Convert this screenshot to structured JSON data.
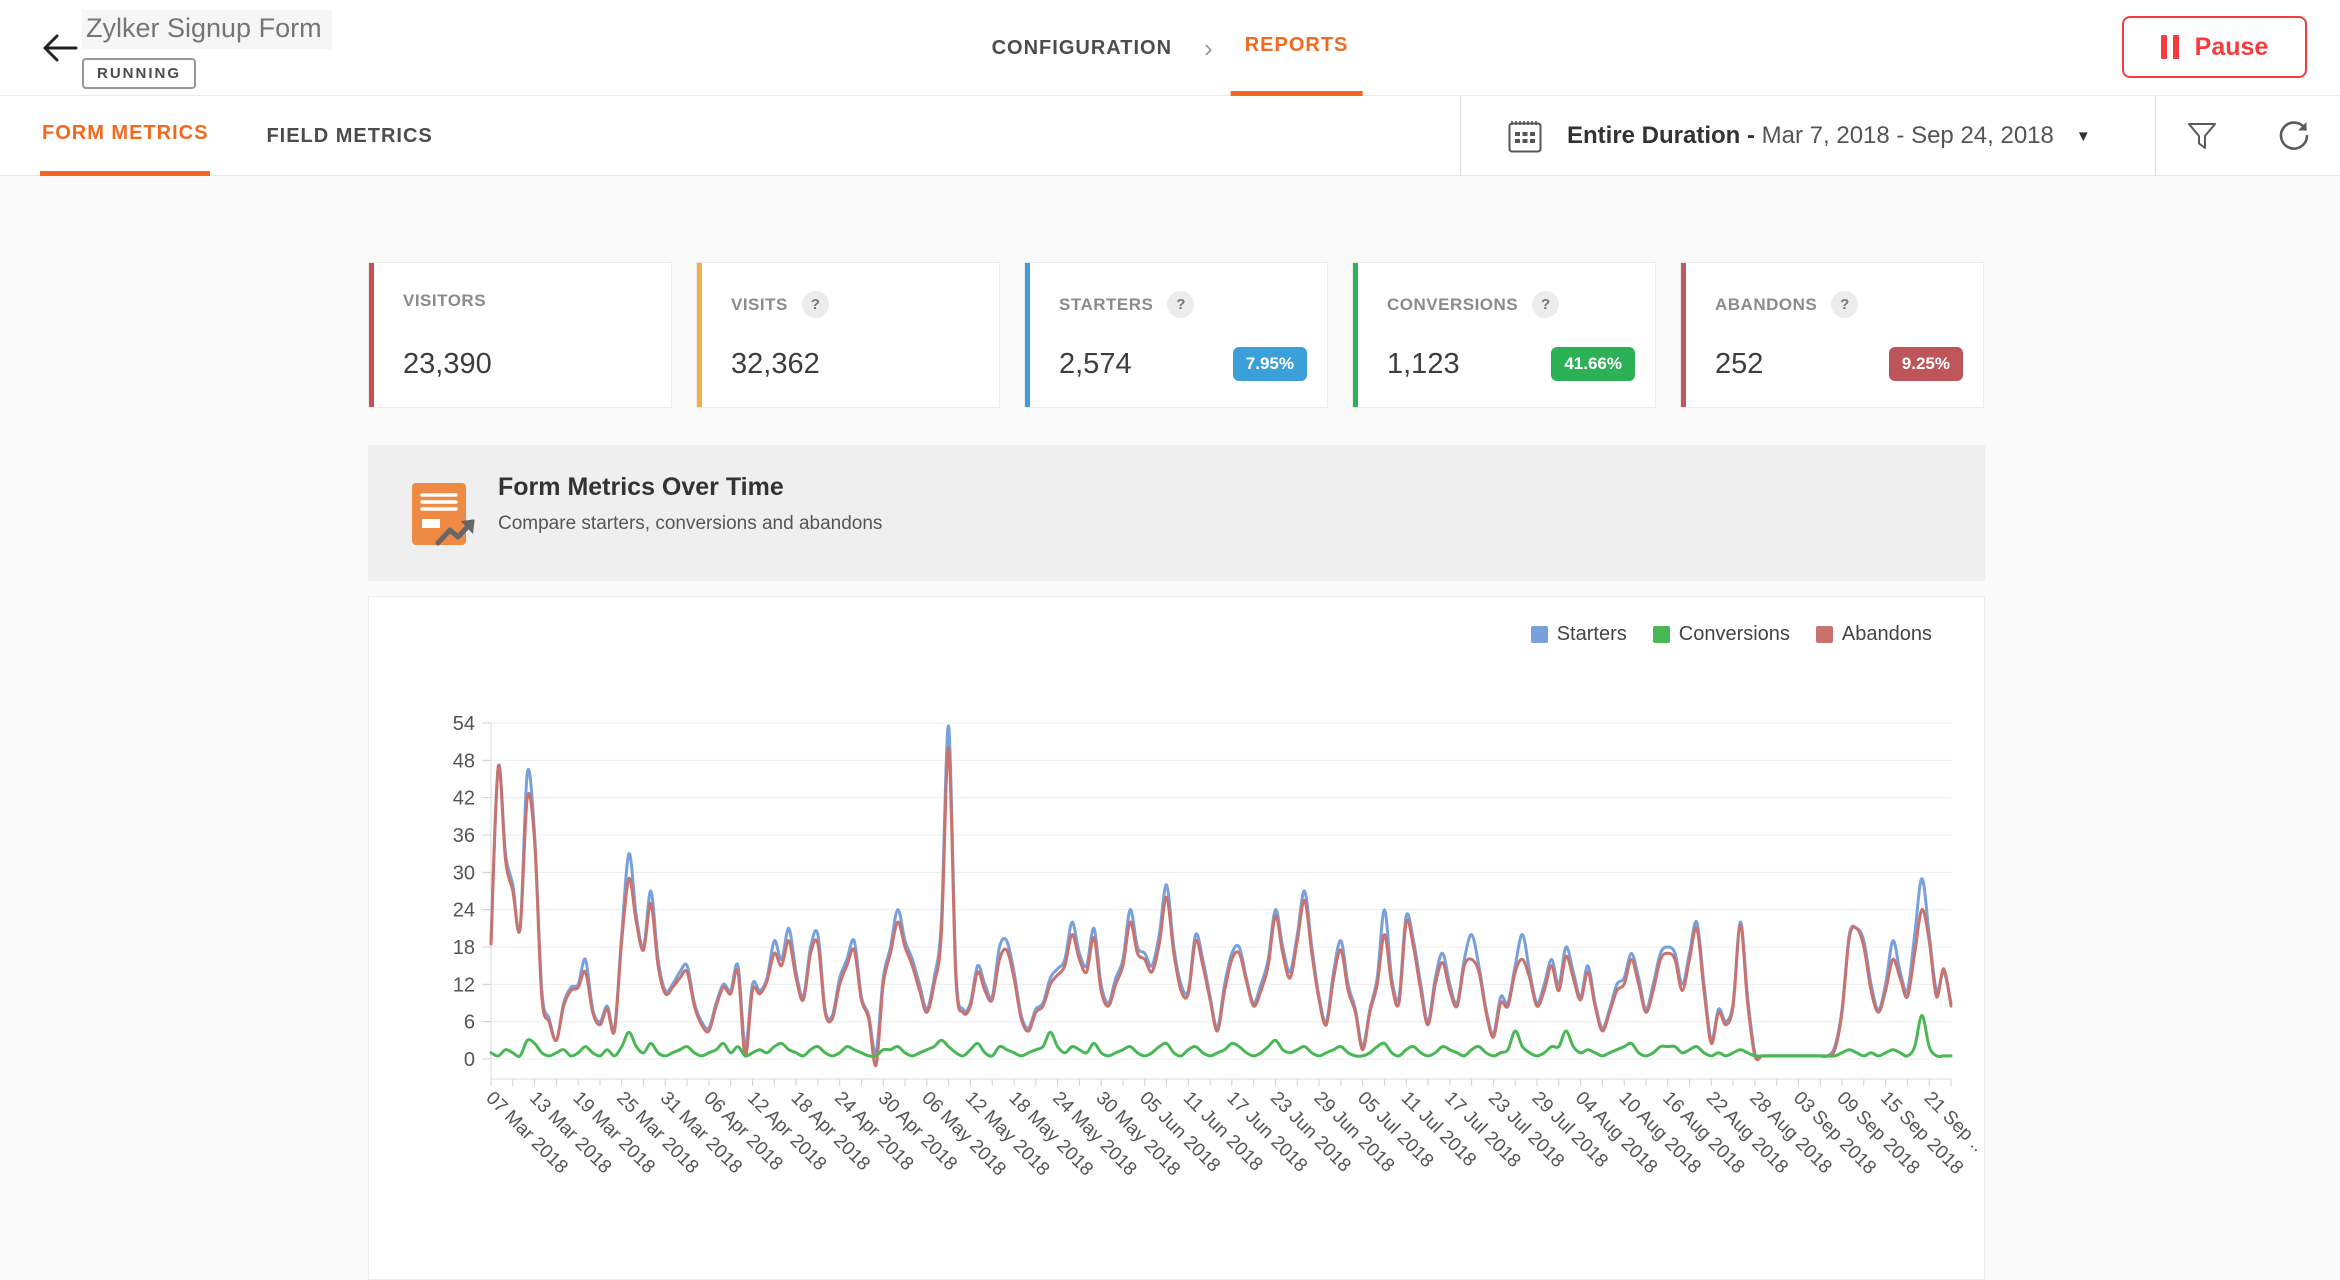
{
  "header": {
    "title": "Zylker Signup Form",
    "status": "RUNNING",
    "breadcrumb": {
      "configuration": "CONFIGURATION",
      "reports": "REPORTS"
    },
    "pause_label": "Pause",
    "accent_orange": "#f2691d",
    "pause_red": "#f53b3e"
  },
  "toolbar": {
    "tabs": [
      {
        "label": "FORM METRICS",
        "active": true
      },
      {
        "label": "FIELD METRICS",
        "active": false
      }
    ],
    "date_range": {
      "prefix": "Entire Duration - ",
      "range": "Mar 7, 2018 - Sep 24, 2018"
    }
  },
  "cards": [
    {
      "label": "VISITORS",
      "value": "23,390",
      "accent": "#c9504e",
      "help": false,
      "badge": null,
      "badge_color": null
    },
    {
      "label": "VISITS",
      "value": "32,362",
      "accent": "#eeb04b",
      "help": true,
      "badge": null,
      "badge_color": null
    },
    {
      "label": "STARTERS",
      "value": "2,574",
      "accent": "#3d9fd9",
      "help": true,
      "badge": "7.95%",
      "badge_color": "#3ba0da"
    },
    {
      "label": "CONVERSIONS",
      "value": "1,123",
      "accent": "#2db156",
      "help": true,
      "badge": "41.66%",
      "badge_color": "#2cb157"
    },
    {
      "label": "ABANDONS",
      "value": "252",
      "accent": "#c2575c",
      "help": true,
      "badge": "9.25%",
      "badge_color": "#bd555a"
    }
  ],
  "section": {
    "title": "Form Metrics Over Time",
    "subtitle": "Compare starters, conversions and abandons"
  },
  "chart_data": {
    "type": "line",
    "title": "Form Metrics Over Time",
    "xlabel": "",
    "ylabel": "",
    "ylim": [
      0,
      54
    ],
    "y_ticks": [
      54,
      48,
      42,
      36,
      30,
      24,
      18,
      12,
      6,
      0
    ],
    "grid": "horizontal",
    "legend_position": "top-right",
    "x_start": "07 Mar 2018",
    "x_end": "24 Sep 2018",
    "x_tick_every_days": 6,
    "x_tick_labels": [
      "07 Mar 2018",
      "13 Mar 2018",
      "19 Mar 2018",
      "25 Mar 2018",
      "31 Mar 2018",
      "06 Apr 2018",
      "12 Apr 2018",
      "18 Apr 2018",
      "24 Apr 2018",
      "30 Apr 2018",
      "06 May 2018",
      "12 May 2018",
      "18 May 2018",
      "24 May 2018",
      "30 May 2018",
      "05 Jun 2018",
      "11 Jun 2018",
      "17 Jun 2018",
      "23 Jun 2018",
      "29 Jun 2018",
      "05 Jul 2018",
      "11 Jul 2018",
      "17 Jul 2018",
      "23 Jul 2018",
      "29 Jul 2018",
      "04 Aug 2018",
      "10 Aug 2018",
      "16 Aug 2018",
      "22 Aug 2018",
      "28 Aug 2018",
      "03 Sep 2018",
      "09 Sep 2018",
      "15 Sep 2018",
      "21 Sep .."
    ],
    "series": [
      {
        "name": "Starters",
        "color": "#78a0dc",
        "values": [
          19,
          47,
          33,
          28,
          21,
          46,
          36,
          11,
          6.5,
          3,
          9,
          11.5,
          12,
          16,
          8,
          6,
          8.5,
          5,
          20,
          33,
          23,
          18,
          27,
          16,
          11,
          12,
          14,
          15,
          9,
          6,
          5,
          9,
          12,
          11,
          15,
          2,
          12,
          11,
          13,
          19,
          16,
          21,
          14,
          10,
          18,
          20,
          8,
          7,
          13,
          16,
          19,
          10,
          7,
          1,
          13,
          18,
          24,
          19,
          16,
          12,
          8,
          13,
          22,
          53.5,
          14,
          8,
          9,
          15,
          12,
          10,
          18,
          19,
          14,
          7,
          5,
          8,
          9,
          13,
          14.5,
          16,
          22,
          17,
          15,
          21,
          12,
          9,
          13,
          16,
          24,
          18,
          17,
          15,
          20,
          28,
          18,
          12,
          11,
          20,
          16,
          10,
          5,
          12,
          17,
          18,
          13,
          9,
          12,
          16,
          24,
          18,
          14,
          20,
          27,
          18,
          10,
          6,
          14,
          19,
          12,
          8,
          2,
          8,
          13,
          24,
          13,
          10,
          23,
          19,
          12,
          6,
          13,
          17,
          12,
          9,
          16,
          20,
          15,
          8,
          4,
          10,
          9,
          15,
          20,
          14,
          9,
          12,
          16,
          12,
          18,
          14,
          10,
          15,
          9,
          5,
          8,
          12,
          13,
          17,
          13,
          8,
          12,
          17,
          18,
          17,
          12,
          17,
          22,
          12,
          3,
          8,
          6,
          9,
          22,
          10,
          1,
          0.5,
          0.5,
          0.5,
          0.5,
          0.5,
          0.5,
          0.5,
          0.5,
          0.5,
          0.5,
          2,
          8,
          20,
          21,
          19,
          12,
          8,
          12,
          19,
          14,
          11,
          20,
          29,
          20,
          11,
          14,
          9
        ]
      },
      {
        "name": "Conversions",
        "color": "#49b854",
        "values": [
          1,
          0.5,
          1.5,
          1,
          0.5,
          3,
          2.5,
          1,
          0.5,
          1,
          1.5,
          0.5,
          1,
          2,
          1,
          0.5,
          1.5,
          0.5,
          2,
          4.3,
          2,
          1,
          2.5,
          1,
          0.5,
          1,
          1.5,
          2,
          1,
          0.5,
          1,
          1.5,
          2.5,
          1,
          2,
          0.5,
          1,
          1.5,
          1,
          2,
          2.5,
          1.5,
          1,
          0.5,
          1.5,
          2,
          1,
          0.5,
          1,
          2,
          1.5,
          1,
          0.5,
          0.5,
          1.5,
          1.5,
          2,
          1,
          0.5,
          1,
          1.5,
          2,
          3,
          2,
          1,
          0.5,
          1.5,
          2.5,
          1,
          0.5,
          2,
          1.5,
          1,
          0.5,
          1,
          1.5,
          2,
          4.3,
          2,
          1,
          2,
          1.5,
          1,
          2.5,
          1,
          0.5,
          1,
          1.5,
          2,
          1,
          0.5,
          1,
          2,
          2.5,
          1,
          0.5,
          1.5,
          2,
          1,
          0.5,
          1,
          1.5,
          2.5,
          2,
          1,
          0.5,
          1,
          2,
          3,
          1.5,
          1,
          1.5,
          2,
          1,
          0.5,
          1,
          1.5,
          2,
          1,
          0.5,
          0.5,
          1,
          2,
          2.5,
          1,
          0.5,
          1.5,
          2,
          1,
          0.5,
          1,
          2,
          1.5,
          1,
          0.5,
          1.5,
          2,
          1,
          0.5,
          1,
          1.5,
          4.5,
          2,
          1,
          0.5,
          1,
          2,
          2,
          4.5,
          2,
          1,
          1.5,
          1,
          0.5,
          1,
          1.5,
          2,
          2.5,
          1,
          0.5,
          1,
          2,
          2,
          2,
          1,
          1.5,
          2,
          1,
          0.5,
          1,
          0.5,
          1,
          1.5,
          1,
          0.5,
          0.5,
          0.5,
          0.5,
          0.5,
          0.5,
          0.5,
          0.5,
          0.5,
          0.5,
          0.5,
          0.5,
          1,
          1.5,
          1,
          0.5,
          1,
          0.5,
          1,
          1.5,
          1,
          0.5,
          2,
          7,
          2,
          0.5,
          0.5,
          0.5
        ]
      },
      {
        "name": "Abandons",
        "color": "#c9736f",
        "values": [
          18.5,
          47,
          32,
          27,
          21,
          42,
          35,
          10,
          6,
          3,
          8.5,
          11,
          11.5,
          14,
          7.5,
          5.5,
          8,
          4.5,
          19,
          29,
          22,
          17.5,
          25,
          15,
          10.5,
          11.5,
          13,
          14,
          8.5,
          5.5,
          4.5,
          8.5,
          11.5,
          10.5,
          14,
          0.5,
          11,
          10.5,
          12.5,
          17,
          15,
          19,
          13,
          9.5,
          17,
          18.5,
          7.5,
          6.5,
          12,
          15,
          17.5,
          9.5,
          6.5,
          -1,
          12,
          17,
          22,
          18,
          15,
          11,
          7.5,
          12,
          20,
          50,
          13,
          7.5,
          8.5,
          14,
          11,
          9.5,
          16,
          17.5,
          13,
          6.5,
          4.5,
          7.5,
          8.5,
          12,
          13.5,
          15,
          20,
          16,
          14,
          19.5,
          11,
          8.5,
          12,
          15,
          22,
          17,
          16,
          14,
          18.5,
          26,
          17,
          11,
          10.5,
          19,
          15,
          9.5,
          4.5,
          11,
          16,
          17,
          12.5,
          8.5,
          11,
          15,
          23,
          17,
          13,
          19,
          25.5,
          17,
          9.5,
          5.5,
          13,
          17.5,
          11,
          7.5,
          1.5,
          7.5,
          12,
          20,
          12,
          9,
          22,
          18,
          11,
          5.5,
          12,
          15.5,
          11,
          8.5,
          15,
          16,
          14,
          7.5,
          3.5,
          9,
          8.5,
          14,
          16,
          13,
          8.5,
          11,
          15,
          11,
          16.5,
          13,
          9.5,
          14,
          8.5,
          4.5,
          7.5,
          11,
          12,
          16,
          12,
          7.5,
          11,
          16,
          17,
          16,
          11,
          16,
          21,
          11,
          2.5,
          7.5,
          5.5,
          8.5,
          21.5,
          9,
          0.5,
          0.5,
          0.5,
          0.5,
          0.5,
          0.5,
          0.5,
          0.5,
          0.5,
          0.5,
          0.5,
          1.5,
          7.5,
          19.5,
          21,
          18,
          11,
          7.5,
          11,
          16,
          13,
          10,
          17,
          24,
          19,
          10,
          14.5,
          8.5
        ]
      }
    ]
  }
}
